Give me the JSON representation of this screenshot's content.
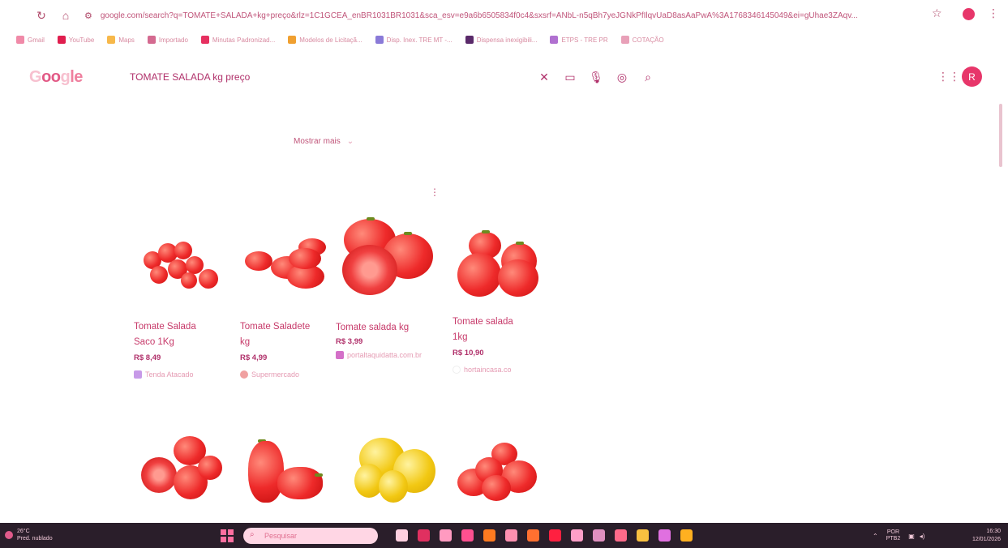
{
  "browser": {
    "url": "google.com/search?q=TOMATE+SALADA+kg+preço&rlz=1C1GCEA_enBR1031BR1031&sca_esv=e9a6b6505834f0c4&sxsrf=ANbL-n5qBh7yeJGNkPfIlqvUaD8asAaPwA%3A1768346145049&ei=gUhae3ZAqv..."
  },
  "bookmarks": [
    {
      "label": "Gmail",
      "color": "#f08aa8"
    },
    {
      "label": "YouTube",
      "color": "#e01e4e"
    },
    {
      "label": "Maps",
      "color": "#f7b84a"
    },
    {
      "label": "Importado",
      "color": "#d46a90"
    },
    {
      "label": "Minutas Padronizad...",
      "color": "#e63060"
    },
    {
      "label": "Modelos de Licitaçã...",
      "color": "#f0a030"
    },
    {
      "label": "Disp. Inex. TRE MT -...",
      "color": "#8a7ad8"
    },
    {
      "label": "Dispensa inexigibili...",
      "color": "#5a2a6a"
    },
    {
      "label": "ETPS - TRE PR",
      "color": "#b070d0"
    },
    {
      "label": "COTAÇÃO",
      "color": "#e8a0b8"
    }
  ],
  "search": {
    "logo_parts": [
      "G",
      "oo",
      "g",
      "le"
    ],
    "query": "TOMATE SALADA kg preço",
    "avatar_letter": "R"
  },
  "show_more_label": "Mostrar mais",
  "products": [
    {
      "title_l1": "Tomate Salada",
      "title_l2": "Saco 1Kg",
      "price": "R$ 8,49",
      "store": "Tenda Atacado",
      "store_color": "#c79ae8"
    },
    {
      "title_l1": "Tomate Saladete",
      "title_l2": "kg",
      "price": "R$ 4,99",
      "store": "Supermercado",
      "store_color": "#f0a0a0"
    },
    {
      "title_l1": "Tomate salada kg",
      "title_l2": "",
      "price": "R$ 3,99",
      "store": "portaltaquidatta.com.br",
      "store_color": "#d470c8"
    },
    {
      "title_l1": "Tomate salada",
      "title_l2": "1kg",
      "price": "R$ 10,90",
      "store": "hortaincasa.co",
      "store_color": "#eeeeee"
    }
  ],
  "taskbar": {
    "temp": "26°C",
    "weather": "Pred. nublado",
    "search_placeholder": "Pesquisar",
    "lang_l1": "POR",
    "lang_l2": "PTB2",
    "time": "16:30",
    "date": "12/01/2026",
    "app_colors": [
      "#ffd0e0",
      "#e03060",
      "#ff9ac0",
      "#ff5090",
      "#ff7a20",
      "#ff90b0",
      "#ff7030",
      "#ff2040",
      "#ff9fc8",
      "#e090c0",
      "#ff6a8a",
      "#f8c040",
      "#e070e0",
      "#ffb020"
    ]
  }
}
